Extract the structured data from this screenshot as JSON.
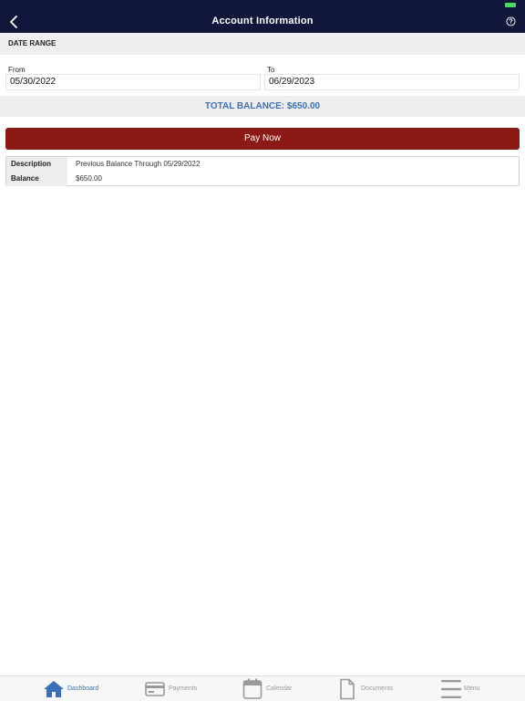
{
  "header": {
    "title": "Account Information"
  },
  "date_range": {
    "section_label": "DATE RANGE",
    "from_label": "From",
    "from_value": "05/30/2022",
    "to_label": "To",
    "to_value": "06/29/2023"
  },
  "total": {
    "text": "TOTAL BALANCE: $650.00"
  },
  "pay_button": {
    "label": "Pay Now"
  },
  "details": {
    "rows": [
      {
        "key": "Description",
        "value": "Previous Balance Through 05/29/2022"
      },
      {
        "key": "Balance",
        "value": "$650.00"
      }
    ]
  },
  "tabs": [
    {
      "label": "Dashboard",
      "icon": "home-icon",
      "active": true
    },
    {
      "label": "Payments",
      "icon": "credit-card-icon",
      "active": false
    },
    {
      "label": "Calendar",
      "icon": "calendar-icon",
      "active": false
    },
    {
      "label": "Documents",
      "icon": "document-icon",
      "active": false
    },
    {
      "label": "Menu",
      "icon": "menu-icon",
      "active": false
    }
  ],
  "colors": {
    "nav_bar": "#11173a",
    "accent_blue": "#3a70b8",
    "pay_button": "#8b1a16"
  }
}
